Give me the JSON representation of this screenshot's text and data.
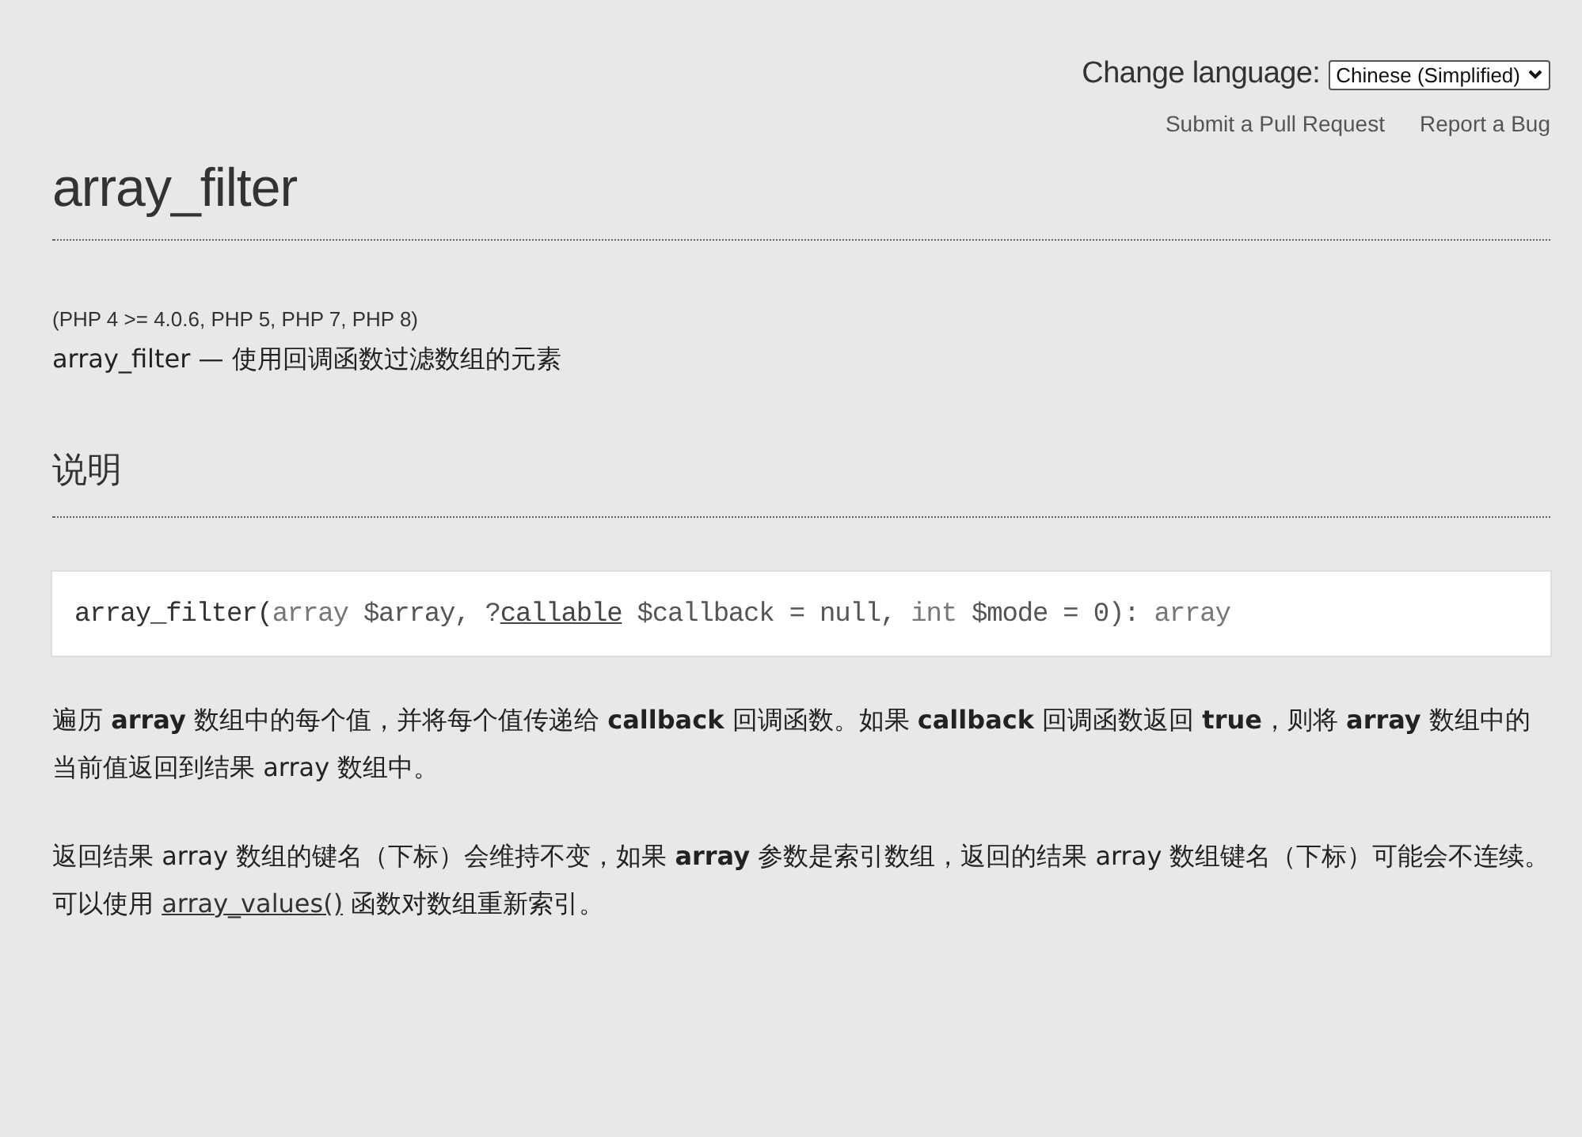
{
  "header": {
    "language_label": "Change language:",
    "language_select": {
      "value": "Chinese (Simplified)"
    },
    "links": [
      "Submit a Pull Request",
      "Report a Bug"
    ]
  },
  "title": "array_filter",
  "versions": "(PHP 4 >= 4.0.6, PHP 5, PHP 7, PHP 8)",
  "purpose": "array_filter — 使用回调函数过滤数组的元素",
  "section_heading": "说明",
  "signature": [
    {
      "kind": "name",
      "text": "array_filter("
    },
    {
      "kind": "type",
      "text": "array"
    },
    {
      "kind": "plain",
      "text": " $array, ?"
    },
    {
      "kind": "link",
      "text": "callable"
    },
    {
      "kind": "plain",
      "text": " $callback = null, "
    },
    {
      "kind": "type",
      "text": "int"
    },
    {
      "kind": "plain",
      "text": " $mode = 0): "
    },
    {
      "kind": "type",
      "text": "array"
    }
  ],
  "paragraphs": [
    {
      "parts": [
        {
          "kind": "text",
          "text": "遍历 **array** 数组中的每个值，并将每个值传递给 **callback** 回调函数。如果 **callback** 回调函数返回 **true**，则将 **array** 数组中的当前值返回到结果 array 数组中。"
        }
      ]
    },
    {
      "parts": [
        {
          "kind": "text",
          "text": "返回结果 array 数组的键名（下标）会维持不变，如果 **array** 参数是索引数组，返回的结果 array 数组键名（下标）可能会不连续。可以使用 "
        },
        {
          "kind": "link",
          "text": "array_values()"
        },
        {
          "kind": "text",
          "text": " 函数对数组重新索引。"
        }
      ]
    }
  ]
}
